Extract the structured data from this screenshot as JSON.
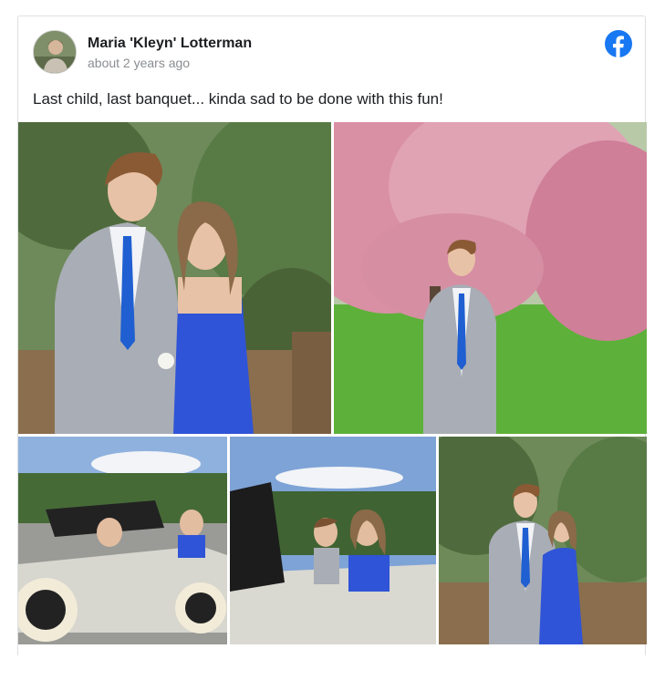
{
  "post": {
    "author": "Maria 'Kleyn' Lotterman",
    "timestamp": "about 2 years ago",
    "text": "Last child, last banquet... kinda sad to be done with this fun!"
  },
  "icons": {
    "brand": "facebook-logo-icon",
    "brand_color": "#1877f2"
  },
  "photos": [
    {
      "name": "couple-pine-trees",
      "scene": "couple"
    },
    {
      "name": "boy-cherry-blossom",
      "scene": "blossom"
    },
    {
      "name": "antique-car-driving",
      "scene": "car"
    },
    {
      "name": "couple-in-car",
      "scene": "car-close"
    },
    {
      "name": "couple-standing",
      "scene": "couple-small"
    }
  ]
}
